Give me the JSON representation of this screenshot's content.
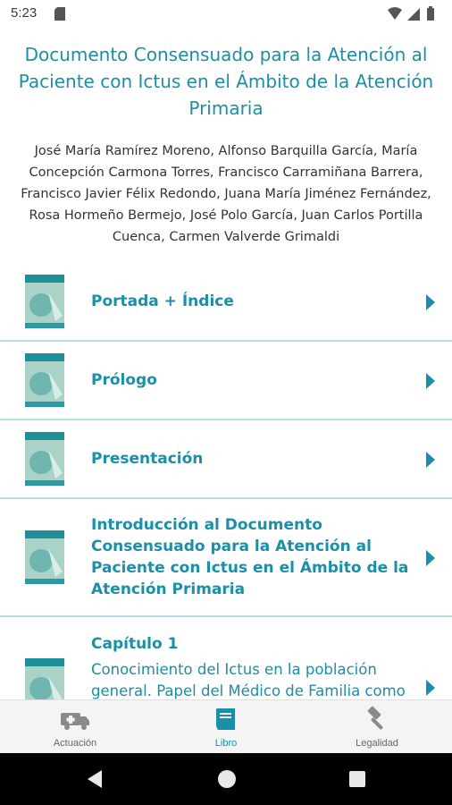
{
  "status": {
    "time": "5:23"
  },
  "book": {
    "title": "Documento Consensuado para la Atención al Paciente con Ictus en el Ámbito de la Atención Primaria",
    "authors": "José María Ramírez Moreno, Alfonso Barquilla García, María Concepción Carmona Torres, Francisco Carramiñana Barrera, Francisco Javier Félix Redondo, Juana María Jiménez Fernández, Rosa Hormeño Bermejo, José Polo García, Juan Carlos Portilla Cuenca, Carmen Valverde Grimaldi"
  },
  "chapters": [
    {
      "title": "Portada + Índice",
      "subtitle": ""
    },
    {
      "title": "Prólogo",
      "subtitle": ""
    },
    {
      "title": "Presentación",
      "subtitle": ""
    },
    {
      "title": "Introducción al Documento Consensuado para la Atención al Paciente con Ictus en el Ámbito de la Atención Primaria",
      "subtitle": ""
    },
    {
      "title": "Capítulo 1",
      "subtitle": "Conocimiento del Ictus en la población general. Papel del Médico de Familia como"
    }
  ],
  "nav": {
    "items": [
      {
        "label": "Actuación",
        "icon": "ambulance-icon"
      },
      {
        "label": "Libro",
        "icon": "book-icon",
        "active": true
      },
      {
        "label": "Legalidad",
        "icon": "gavel-icon"
      }
    ]
  },
  "colors": {
    "accent": "#1a8fa8",
    "divider": "#b9dfe7",
    "nav_active": "#1a8fa8",
    "nav_inactive": "#8a8a8a"
  }
}
